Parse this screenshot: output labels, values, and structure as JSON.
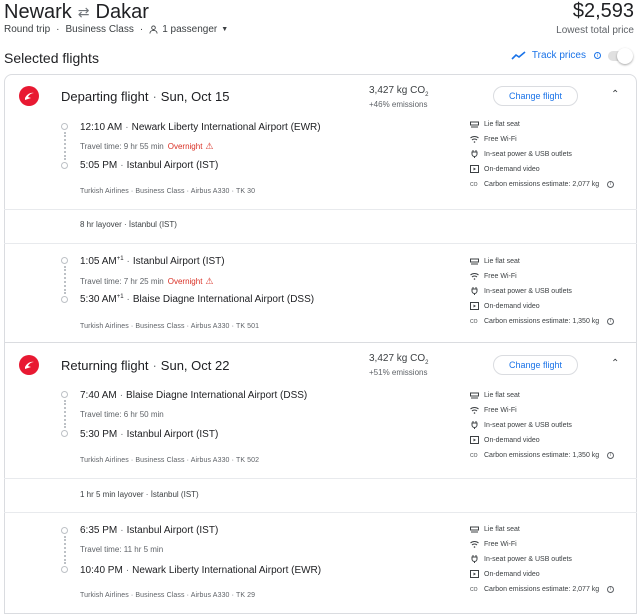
{
  "header": {
    "origin": "Newark",
    "destination": "Dakar",
    "trip_type": "Round trip",
    "cabin": "Business Class",
    "passengers": "1 passenger",
    "price": "$2,593",
    "price_label": "Lowest total price"
  },
  "section_title": "Selected flights",
  "track_prices": "Track prices",
  "amenities": {
    "lie_flat": "Lie flat seat",
    "wifi": "Free Wi-Fi",
    "power": "In-seat power & USB outlets",
    "video": "On-demand video"
  },
  "departing": {
    "title": "Departing flight",
    "date": "Sun, Oct 15",
    "co2": "3,427 kg CO",
    "co2_sub": "2",
    "emissions": "+46% emissions",
    "change": "Change flight",
    "seg1": {
      "dep_time": "12:10 AM",
      "dep_airport": "Newark Liberty International Airport (EWR)",
      "travel": "Travel time: 9 hr 55 min",
      "overnight": "Overnight",
      "arr_time": "5:05 PM",
      "arr_airport": "Istanbul Airport (IST)",
      "meta": "Turkish Airlines · Business Class · Airbus A330 · TK 30",
      "carbon": "Carbon emissions estimate: 2,077 kg"
    },
    "layover": "8 hr layover · İstanbul (IST)",
    "seg2": {
      "dep_time": "1:05 AM",
      "dep_sup": "+1",
      "dep_airport": "Istanbul Airport (IST)",
      "travel": "Travel time: 7 hr 25 min",
      "overnight": "Overnight",
      "arr_time": "5:30 AM",
      "arr_sup": "+1",
      "arr_airport": "Blaise Diagne International Airport (DSS)",
      "meta": "Turkish Airlines · Business Class · Airbus A330 · TK 501",
      "carbon": "Carbon emissions estimate: 1,350 kg"
    }
  },
  "returning": {
    "title": "Returning flight",
    "date": "Sun, Oct 22",
    "co2": "3,427 kg CO",
    "co2_sub": "2",
    "emissions": "+51% emissions",
    "change": "Change flight",
    "seg1": {
      "dep_time": "7:40 AM",
      "dep_airport": "Blaise Diagne International Airport (DSS)",
      "travel": "Travel time: 6 hr 50 min",
      "arr_time": "5:30 PM",
      "arr_airport": "Istanbul Airport (IST)",
      "meta": "Turkish Airlines · Business Class · Airbus A330 · TK 502",
      "carbon": "Carbon emissions estimate: 1,350 kg"
    },
    "layover": "1 hr 5 min layover · İstanbul (IST)",
    "seg2": {
      "dep_time": "6:35 PM",
      "dep_airport": "Istanbul Airport (IST)",
      "travel": "Travel time: 11 hr 5 min",
      "arr_time": "10:40 PM",
      "arr_airport": "Newark Liberty International Airport (EWR)",
      "meta": "Turkish Airlines · Business Class · Airbus A330 · TK 29",
      "carbon": "Carbon emissions estimate: 2,077 kg"
    }
  }
}
